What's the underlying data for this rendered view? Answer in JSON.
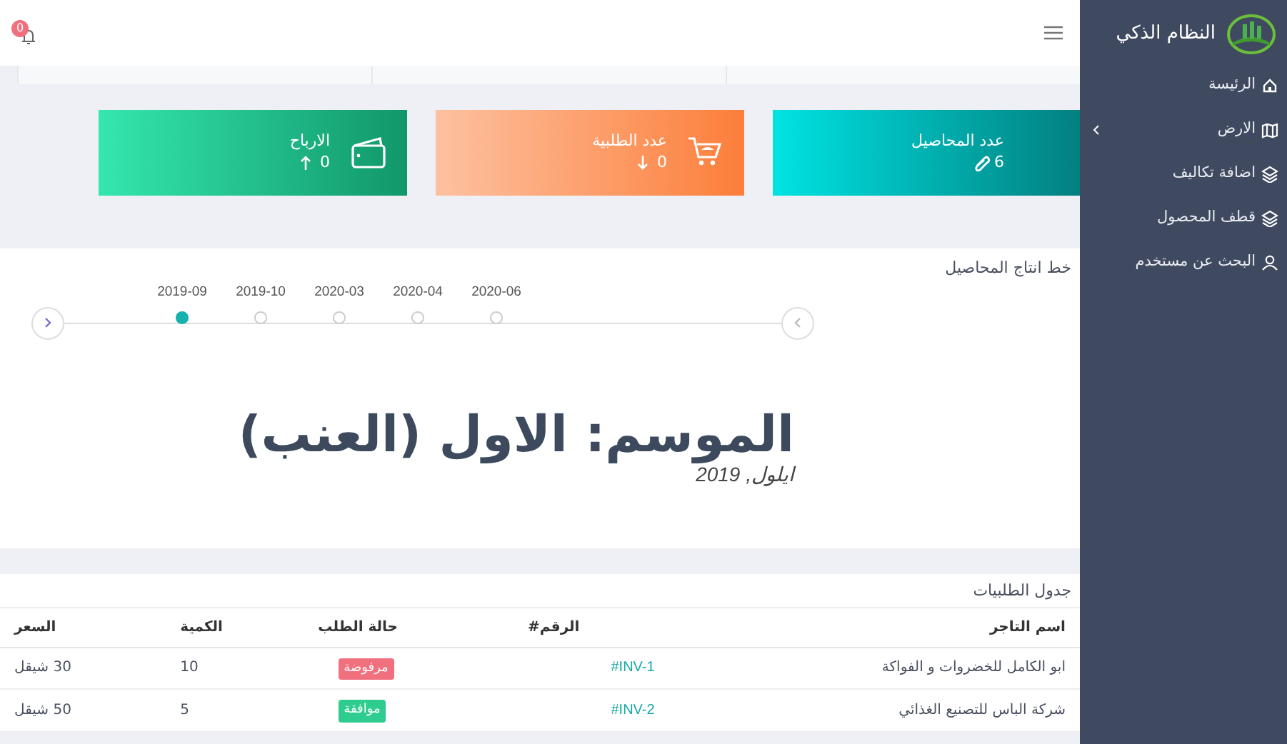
{
  "topbar": {
    "notifications": "0"
  },
  "sidebar": {
    "title": "النظام الذكي",
    "items": [
      {
        "label": "الرئيسة",
        "kind": "home",
        "expandable": false
      },
      {
        "label": "الارض",
        "kind": "map",
        "expandable": true
      },
      {
        "label": "اضافة تكاليف",
        "kind": "layers",
        "expandable": false
      },
      {
        "label": "قطف المحصول",
        "kind": "layers",
        "expandable": false
      },
      {
        "label": "البحث عن مستخدم",
        "kind": "user",
        "expandable": false
      }
    ]
  },
  "stats": [
    {
      "kind": "crops",
      "label": "عدد المحاصيل",
      "value": "6"
    },
    {
      "kind": "orders",
      "label": "عدد الطلبية",
      "value": "0"
    },
    {
      "kind": "profits",
      "label": "الارباح",
      "value": "0"
    }
  ],
  "timeline": {
    "title": "خط انتاج المحاصيل",
    "dates": [
      {
        "label": "2020-06",
        "selected": false
      },
      {
        "label": "2020-04",
        "selected": false
      },
      {
        "label": "2020-03",
        "selected": false
      },
      {
        "label": "2019-10",
        "selected": false
      },
      {
        "label": "2019-09",
        "selected": true
      }
    ],
    "season": "الموسم: الاول (العنب)",
    "date": "ايلول, 2019"
  },
  "orders": {
    "title": "جدول الطلبيات",
    "columns": [
      "اسم التاجر",
      "الرقم#",
      "حالة الطلب",
      "الكمية",
      "السعر"
    ],
    "rows": [
      {
        "merchant": "ابو الكامل للخضروات و الفواكة",
        "number": "#INV-1",
        "status": "مرفوضة",
        "color": "#f0707e",
        "quantity": "10",
        "price": "30 شيقل"
      },
      {
        "merchant": "شركة الباس للتصنيع الغذائي",
        "number": "#INV-2",
        "status": "موافقة",
        "color": "#2ecc8f",
        "quantity": "5",
        "price": "50 شيقل"
      }
    ]
  }
}
